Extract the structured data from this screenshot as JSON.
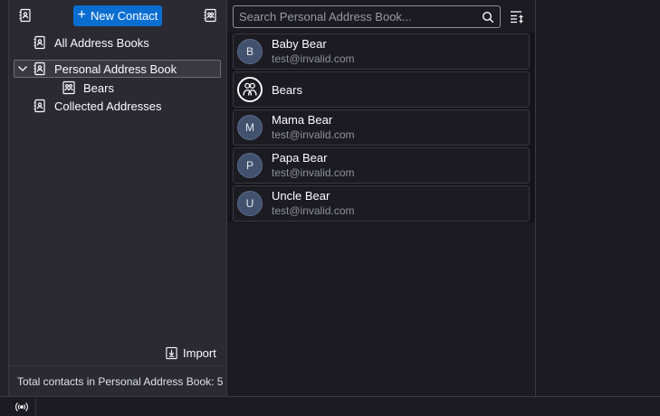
{
  "left": {
    "new_contact_label": "New Contact",
    "address_books": [
      {
        "label": "All Address Books"
      },
      {
        "label": "Personal Address Book"
      },
      {
        "label": "Bears"
      },
      {
        "label": "Collected Addresses"
      }
    ],
    "import_label": "Import",
    "footer_text": "Total contacts in Personal Address Book: 5"
  },
  "search": {
    "placeholder": "Search Personal Address Book..."
  },
  "contacts": [
    {
      "initial": "B",
      "name": "Baby Bear",
      "email": "test@invalid.com"
    },
    {
      "initial": "",
      "name": "Bears",
      "email": ""
    },
    {
      "initial": "M",
      "name": "Mama Bear",
      "email": "test@invalid.com"
    },
    {
      "initial": "P",
      "name": "Papa Bear",
      "email": "test@invalid.com"
    },
    {
      "initial": "U",
      "name": "Uncle Bear",
      "email": "test@invalid.com"
    }
  ],
  "colors": {
    "accent": "#0a6ed1",
    "pane_bg": "#2b2a33",
    "app_bg": "#1c1b22",
    "avatar_bg": "#42526e"
  },
  "icons": {
    "address_book": "address-book-icon",
    "list": "list-icon",
    "search": "search-icon",
    "options": "list-options-icon",
    "import": "import-icon",
    "status": "online-status-icon"
  }
}
